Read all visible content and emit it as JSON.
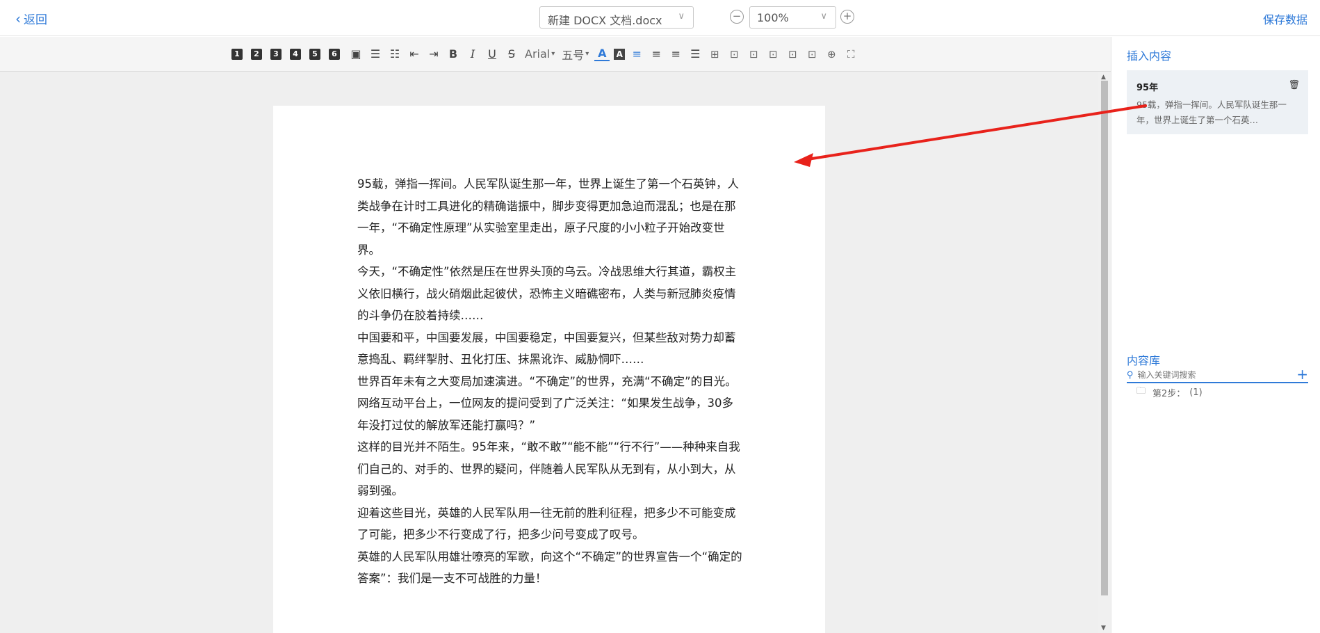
{
  "topbar": {
    "back_label": "返回",
    "document_name": "新建 DOCX 文档.docx",
    "zoom_value": "100%",
    "zoom_out_icon": "minus-circle-icon",
    "zoom_in_icon": "plus-circle-icon",
    "save_label": "保存数据"
  },
  "toolbar": {
    "heading_buttons": [
      "1",
      "2",
      "3",
      "4",
      "5",
      "6"
    ],
    "font_family": "Arial",
    "font_size": "五号",
    "bold": "B",
    "italic": "I",
    "underline": "U",
    "strike": "S",
    "font_color": "A",
    "bg_color": "A"
  },
  "document": {
    "paragraphs": [
      "95载，弹指一挥间。人民军队诞生那一年，世界上诞生了第一个石英钟，人类战争在计时工具进化的精确谐振中，脚步变得更加急迫而混乱；也是在那一年，“不确定性原理”从实验室里走出，原子尺度的小小粒子开始改变世界。",
      "今天，“不确定性”依然是压在世界头顶的乌云。冷战思维大行其道，霸权主义依旧横行，战火硝烟此起彼伏，恐怖主义暗礁密布，人类与新冠肺炎疫情的斗争仍在胶着持续……",
      "中国要和平，中国要发展，中国要稳定，中国要复兴，但某些敌对势力却蓄意捣乱、羁绊掣肘、丑化打压、抹黑讹诈、威胁恫吓……",
      "世界百年未有之大变局加速演进。“不确定”的世界，充满“不确定”的目光。网络互动平台上，一位网友的提问受到了广泛关注：“如果发生战争，30多年没打过仗的解放军还能打赢吗？”",
      "这样的目光并不陌生。95年来，“敢不敢”“能不能”“行不行”——种种来自我们自己的、对手的、世界的疑问，伴随着人民军队从无到有，从小到大，从弱到强。",
      "迎着这些目光，英雄的人民军队用一往无前的胜利征程，把多少不可能变成了可能，把多少不行变成了行，把多少问号变成了叹号。",
      "英雄的人民军队用雄壮嘹亮的军歌，向这个“不确定”的世界宣告一个“确定的答案”：我们是一支不可战胜的力量！"
    ]
  },
  "panel": {
    "insert_title": "插入内容",
    "card": {
      "title": "95年",
      "preview": "95载，弹指一挥间。人民军队诞生那一年，世界上诞生了第一个石英…",
      "delete_icon": "trash-icon"
    },
    "library_title": "内容库",
    "search_placeholder": "输入关键词搜索",
    "folder": {
      "label": "第2步：",
      "count": "(1)"
    }
  },
  "colors": {
    "accent": "#2f7ad8",
    "annotation_arrow": "#e8221b",
    "card_bg": "#edf1f5",
    "editor_bg": "#efefef"
  }
}
